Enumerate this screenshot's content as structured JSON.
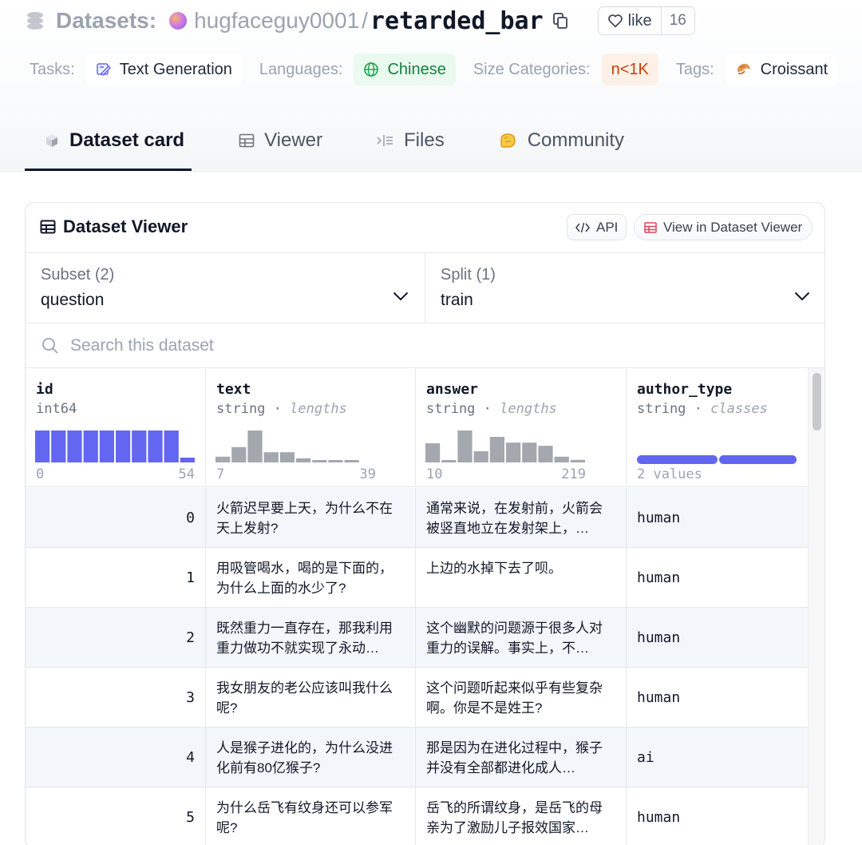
{
  "breadcrumb": {
    "root": "Datasets:",
    "owner": "hugfaceguy0001",
    "separator": "/",
    "repo": "retarded_bar",
    "like_label": "like",
    "like_count": "16"
  },
  "tags": {
    "tasks_label": "Tasks:",
    "task": "Text Generation",
    "languages_label": "Languages:",
    "language": "Chinese",
    "size_label": "Size Categories:",
    "size": "n<1K",
    "tags_label": "Tags:",
    "tag": "Croissant"
  },
  "tabs": [
    {
      "label": "Dataset card",
      "icon": "cube-icon",
      "active": true
    },
    {
      "label": "Viewer",
      "icon": "table-icon",
      "active": false
    },
    {
      "label": "Files",
      "icon": "files-icon",
      "active": false
    },
    {
      "label": "Community",
      "icon": "community-icon",
      "active": false
    }
  ],
  "viewer": {
    "title": "Dataset Viewer",
    "api_label": "API",
    "view_label": "View in Dataset Viewer",
    "subset_label": "Subset (2)",
    "subset_value": "question",
    "split_label": "Split (1)",
    "split_value": "train",
    "search_placeholder": "Search this dataset"
  },
  "columns": [
    {
      "name": "id",
      "type": "int64",
      "kind": "",
      "min": "0",
      "max": "54",
      "hist": [
        1,
        1,
        1,
        1,
        1,
        1,
        1,
        1,
        1,
        0.15
      ]
    },
    {
      "name": "text",
      "type": "string",
      "kind": "lengths",
      "min": "7",
      "max": "39",
      "hist": [
        0.18,
        0.48,
        1,
        0.32,
        0.32,
        0.13,
        0.05,
        0.05,
        0.05
      ]
    },
    {
      "name": "answer",
      "type": "string",
      "kind": "lengths",
      "min": "10",
      "max": "219",
      "hist": [
        0.6,
        0.07,
        1,
        0.35,
        0.8,
        0.62,
        0.62,
        0.52,
        0.18,
        0.08
      ]
    },
    {
      "name": "author_type",
      "type": "string",
      "kind": "classes",
      "summary": "2 values"
    }
  ],
  "rows": [
    {
      "id": "0",
      "text": "火箭迟早要上天，为什么不在天上发射?",
      "answer": "通常来说，在发射前，火箭会被竖直地立在发射架上，…",
      "author_type": "human"
    },
    {
      "id": "1",
      "text": "用吸管喝水，喝的是下面的，为什么上面的水少了?",
      "answer": "上边的水掉下去了呗。",
      "author_type": "human"
    },
    {
      "id": "2",
      "text": "既然重力一直存在，那我利用重力做功不就实现了永动…",
      "answer": "这个幽默的问题源于很多人对重力的误解。事实上，不…",
      "author_type": "human"
    },
    {
      "id": "3",
      "text": "我女朋友的老公应该叫我什么呢?",
      "answer": "这个问题听起来似乎有些复杂啊。你是不是姓王?",
      "author_type": "human"
    },
    {
      "id": "4",
      "text": "人是猴子进化的，为什么没进化前有80亿猴子?",
      "answer": "那是因为在进化过程中，猴子并没有全部都进化成人…",
      "author_type": "ai"
    },
    {
      "id": "5",
      "text": "为什么岳飞有纹身还可以参军呢?",
      "answer": "岳飞的所谓纹身，是岳飞的母亲为了激励儿子报效国家…",
      "author_type": "human"
    }
  ],
  "colors": {
    "accent": "#6366f1",
    "hist_gray": "#a3a7ae",
    "chip_green": "#15803d",
    "chip_orange": "#c2410c"
  }
}
